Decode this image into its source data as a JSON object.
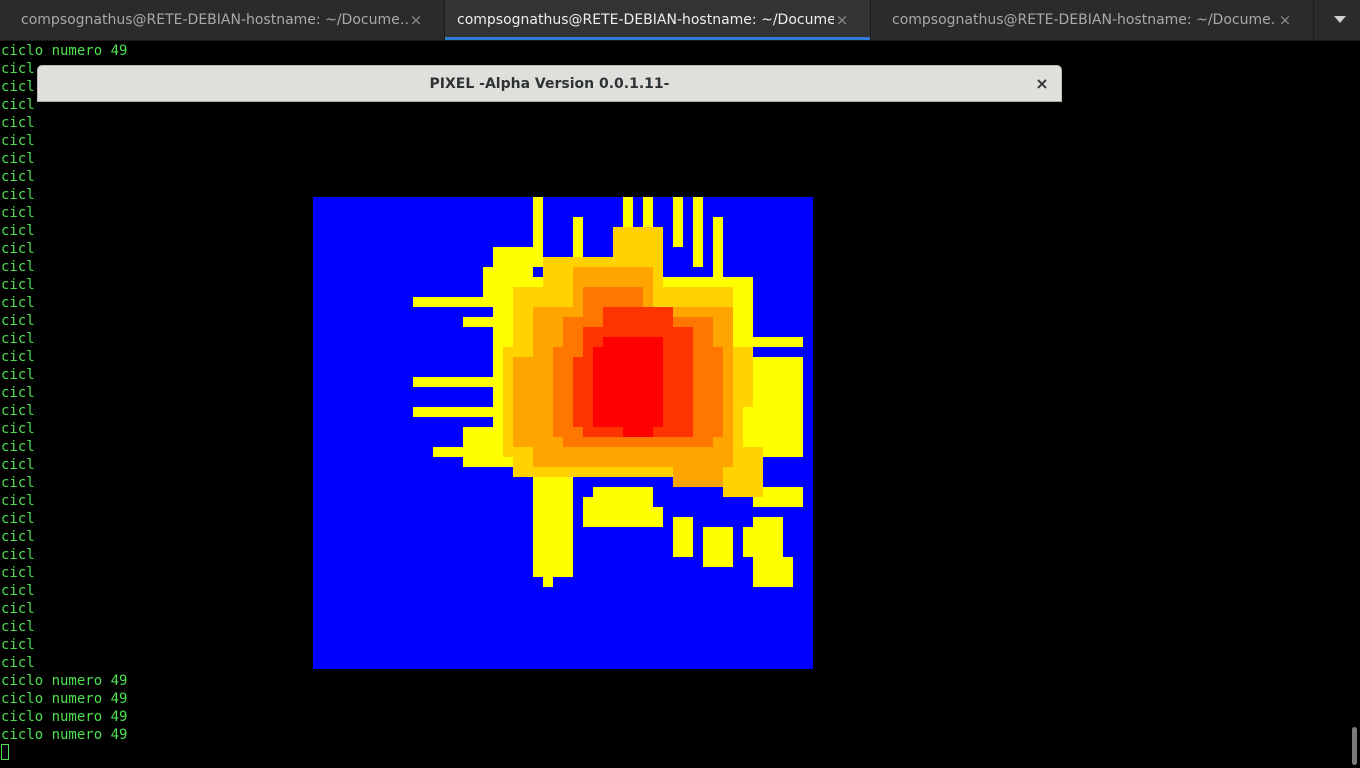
{
  "tabs": [
    {
      "label": "compsognathus@RETE-DEBIAN-hostname: ~/Docume…",
      "active": false
    },
    {
      "label": "compsognathus@RETE-DEBIAN-hostname: ~/Docume…",
      "active": true
    },
    {
      "label": "compsognathus@RETE-DEBIAN-hostname: ~/Docume…",
      "active": false
    }
  ],
  "tab_close_glyph": "×",
  "terminal": {
    "lines": [
      "ciclo numero 49",
      "cicl",
      "cicl",
      "cicl",
      "cicl",
      "cicl",
      "cicl",
      "cicl",
      "cicl",
      "cicl",
      "cicl",
      "cicl",
      "cicl",
      "cicl",
      "cicl",
      "cicl",
      "cicl",
      "cicl",
      "cicl",
      "cicl",
      "cicl",
      "cicl",
      "cicl",
      "cicl",
      "cicl",
      "cicl",
      "cicl",
      "cicl",
      "cicl",
      "cicl",
      "cicl",
      "cicl",
      "cicl",
      "cicl",
      "cicl",
      "ciclo numero 49",
      "ciclo numero 49",
      "ciclo numero 49",
      "ciclo numero 49"
    ],
    "text_color": "#4ee04e"
  },
  "popup": {
    "title": "PIXEL -Alpha Version 0.0.1.11-",
    "close_glyph": "×"
  },
  "canvas": {
    "background": "#0000ff",
    "palette": [
      "#ffff00",
      "#ffd200",
      "#ffa500",
      "#ff7700",
      "#ff3300",
      "#ff0000"
    ]
  }
}
